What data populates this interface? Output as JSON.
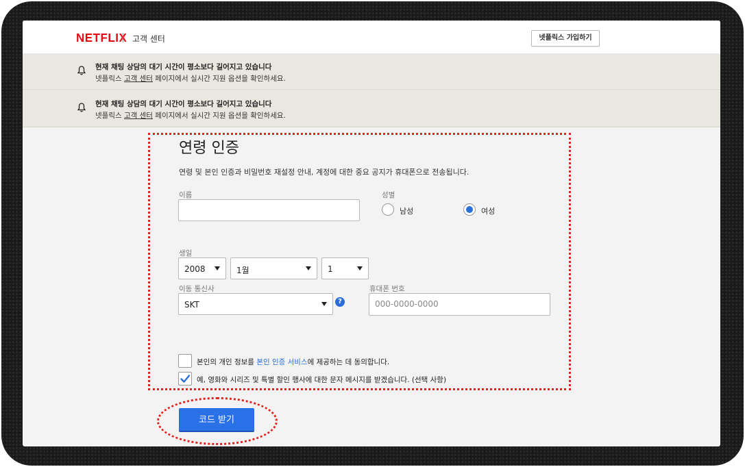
{
  "header": {
    "logo": "NETFLIX",
    "section_title": "고객 센터",
    "signup_button": "넷플릭스 가입하기"
  },
  "banners": [
    {
      "icon": "bell-icon",
      "title": "현재 채팅 상담의 대기 시간이 평소보다 길어지고 있습니다",
      "text_prefix": "넷플릭스 ",
      "text_link": "고객 센터",
      "text_suffix": " 페이지에서 실시간 지원 옵션을 확인하세요."
    },
    {
      "icon": "bell-icon",
      "title": "현재 채팅 상담의 대기 시간이 평소보다 길어지고 있습니다",
      "text_prefix": "넷플릭스 ",
      "text_link": "고객 센터",
      "text_suffix": " 페이지에서 실시간 지원 옵션을 확인하세요."
    }
  ],
  "form": {
    "title": "연령 인증",
    "description": "연령 및 본인 인증과 비밀번호 재설정 안내, 계정에 대한 중요 공지가 휴대폰으로 전송됩니다.",
    "name_label": "이름",
    "name_value": "",
    "gender_label": "성별",
    "gender_options": [
      "남성",
      "여성"
    ],
    "gender_selected": "여성",
    "birth_label": "생일",
    "birth_year": "2008",
    "birth_month": "1월",
    "birth_day": "1",
    "carrier_label": "이동 통신사",
    "carrier_value": "SKT",
    "carrier_help": "?",
    "phone_label": "휴대폰 번호",
    "phone_placeholder": "000-0000-0000",
    "consent1_prefix": "본인의 개인 정보를 ",
    "consent1_link": "본인 인증 서비스",
    "consent1_suffix": "에 제공하는 데 동의합니다.",
    "consent1_checked": false,
    "consent2": "예, 영화와 시리즈 및 특별 할인 행사에 대한 문자 메시지를 받겠습니다. (선택 사항)",
    "consent2_checked": true,
    "submit_button": "코드 받기"
  },
  "colors": {
    "brand_red": "#e50914",
    "accent_blue": "#2a71e8",
    "annotation_red": "#e0231e"
  }
}
